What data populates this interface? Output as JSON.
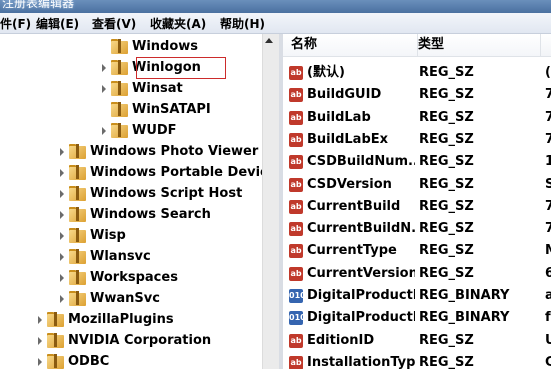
{
  "window": {
    "title": "注册表编辑器"
  },
  "menu": [
    "文件(F)",
    "编辑(E)",
    "查看(V)",
    "收藏夹(A)",
    "帮助(H)"
  ],
  "tree": [
    {
      "label": "Windows",
      "expander": false
    },
    {
      "label": "Winlogon",
      "expander": true,
      "highlighted": true
    },
    {
      "label": "Winsat",
      "expander": true
    },
    {
      "label": "WinSATAPI",
      "expander": false
    },
    {
      "label": "WUDF",
      "expander": true
    },
    {
      "label": "Windows Photo Viewer",
      "expander": true
    },
    {
      "label": "Windows Portable Devices",
      "expander": true
    },
    {
      "label": "Windows Script Host",
      "expander": true
    },
    {
      "label": "Windows Search",
      "expander": true
    },
    {
      "label": "Wisp",
      "expander": true
    },
    {
      "label": "Wlansvc",
      "expander": true
    },
    {
      "label": "Workspaces",
      "expander": true
    },
    {
      "label": "WwanSvc",
      "expander": true
    },
    {
      "label": "MozillaPlugins",
      "expander": true
    },
    {
      "label": "NVIDIA Corporation",
      "expander": true
    },
    {
      "label": "ODBC",
      "expander": true
    }
  ],
  "list": {
    "columns": {
      "name": "名称",
      "type": "类型"
    },
    "rows": [
      {
        "icon": "ab",
        "name": "(默认)",
        "type": "REG_SZ",
        "data": "(数"
      },
      {
        "icon": "ab",
        "name": "BuildGUID",
        "type": "REG_SZ",
        "data": "7"
      },
      {
        "icon": "ab",
        "name": "BuildLab",
        "type": "REG_SZ",
        "data": "7"
      },
      {
        "icon": "ab",
        "name": "BuildLabEx",
        "type": "REG_SZ",
        "data": "7"
      },
      {
        "icon": "ab",
        "name": "CSDBuildNum...",
        "type": "REG_SZ",
        "data": "1"
      },
      {
        "icon": "ab",
        "name": "CSDVersion",
        "type": "REG_SZ",
        "data": "S"
      },
      {
        "icon": "ab",
        "name": "CurrentBuild",
        "type": "REG_SZ",
        "data": "7"
      },
      {
        "icon": "ab",
        "name": "CurrentBuildN...",
        "type": "REG_SZ",
        "data": "7"
      },
      {
        "icon": "ab",
        "name": "CurrentType",
        "type": "REG_SZ",
        "data": "M"
      },
      {
        "icon": "ab",
        "name": "CurrentVersion",
        "type": "REG_SZ",
        "data": "6"
      },
      {
        "icon": "bin",
        "name": "DigitalProductId",
        "type": "REG_BINARY",
        "data": "a"
      },
      {
        "icon": "bin",
        "name": "DigitalProductI...",
        "type": "REG_BINARY",
        "data": "f"
      },
      {
        "icon": "ab",
        "name": "EditionID",
        "type": "REG_SZ",
        "data": "U"
      },
      {
        "icon": "ab",
        "name": "InstallationType",
        "type": "REG_SZ",
        "data": "C"
      }
    ]
  },
  "icons": {
    "string_value": "ab",
    "binary_value": "010"
  },
  "colors": {
    "highlight_border": "#cc2b2b",
    "string_icon": "#c0392b",
    "binary_icon": "#3565b0"
  }
}
